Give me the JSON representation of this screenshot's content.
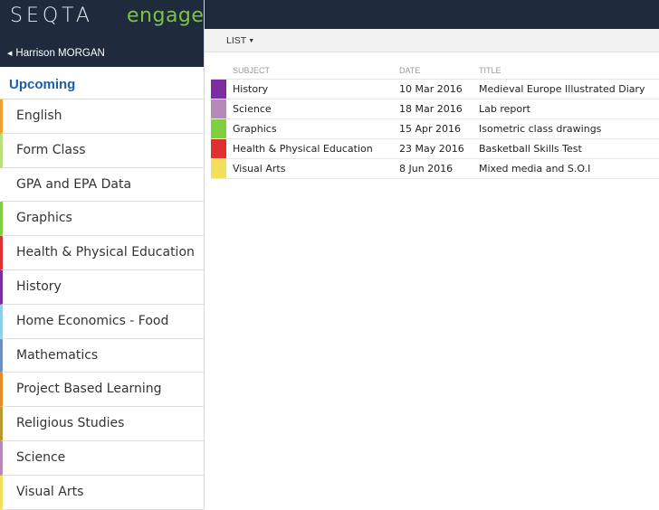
{
  "brand": {
    "name": "SEQTA",
    "product": "engage"
  },
  "user": {
    "name": "Harrison MORGAN"
  },
  "sidebar": {
    "heading": "Upcoming",
    "items": [
      {
        "label": "English",
        "color": "#f0a030"
      },
      {
        "label": "Form Class",
        "color": "#b7e07a"
      },
      {
        "label": "GPA and EPA Data",
        "color": "#ffffff"
      },
      {
        "label": "Graphics",
        "color": "#7fcf3f"
      },
      {
        "label": "Health & Physical Education",
        "color": "#e03030"
      },
      {
        "label": "History",
        "color": "#7a2fa0"
      },
      {
        "label": "Home Economics - Food",
        "color": "#8fd0e6"
      },
      {
        "label": "Mathematics",
        "color": "#6f8fbf"
      },
      {
        "label": "Project Based Learning",
        "color": "#e88a25"
      },
      {
        "label": "Religious Studies",
        "color": "#b89a2e"
      },
      {
        "label": "Science",
        "color": "#b58ab8"
      },
      {
        "label": "Visual Arts",
        "color": "#f3e05a"
      }
    ]
  },
  "toolbar": {
    "view_label": "LIST"
  },
  "table": {
    "headers": {
      "subject": "SUBJECT",
      "date": "DATE",
      "title": "TITLE"
    },
    "rows": [
      {
        "subject": "History",
        "date": "10 Mar 2016",
        "title": "Medieval Europe Illustrated Diary",
        "color": "#7a2fa0"
      },
      {
        "subject": "Science",
        "date": "18 Mar 2016",
        "title": "Lab report",
        "color": "#b58ab8"
      },
      {
        "subject": "Graphics",
        "date": "15 Apr 2016",
        "title": "Isometric class drawings",
        "color": "#7fcf3f"
      },
      {
        "subject": "Health & Physical Education",
        "date": "23 May 2016",
        "title": "Basketball Skills Test",
        "color": "#e03030"
      },
      {
        "subject": "Visual Arts",
        "date": "8 Jun 2016",
        "title": "Mixed media and S.O.I",
        "color": "#f3e05a"
      }
    ]
  }
}
